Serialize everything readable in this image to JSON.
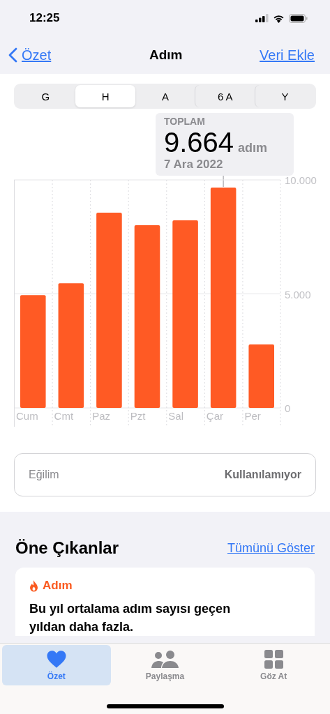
{
  "status_bar": {
    "time": "12:25"
  },
  "nav": {
    "back": "Özet",
    "title": "Adım",
    "action": "Veri Ekle"
  },
  "segments": [
    {
      "label": "G",
      "selected": false
    },
    {
      "label": "H",
      "selected": true
    },
    {
      "label": "A",
      "selected": false
    },
    {
      "label": "6 A",
      "selected": false
    },
    {
      "label": "Y",
      "selected": false
    }
  ],
  "summary": {
    "caption": "TOPLAM",
    "value": "9.664",
    "unit": "adım",
    "date": "7 Ara 2022"
  },
  "chart": {
    "chart_data": {
      "type": "bar",
      "categories": [
        "Cum",
        "Cmt",
        "Paz",
        "Pzt",
        "Sal",
        "Çar",
        "Per"
      ],
      "series": [
        {
          "color": "#ff5a24",
          "values": [
            4950,
            5470,
            8560,
            8010,
            8230,
            9660,
            2780
          ]
        }
      ],
      "ylim": [
        0,
        10000
      ],
      "yticks": [
        0,
        {
          "value": 5000,
          "label": "5.000"
        },
        {
          "value": 10000,
          "label": "10.000"
        }
      ]
    }
  },
  "trend": {
    "label": "Eğilim",
    "value": "Kullanılamıyor"
  },
  "highlights": {
    "title": "Öne Çıkanlar",
    "link": "Tümünü Göster",
    "cards": [
      {
        "category": "Adım",
        "text": "Bu yıl ortalama adım sayısı geçen yıldan daha fazla."
      }
    ]
  },
  "tab_bar": [
    {
      "kind": "summary",
      "label": "Özet",
      "selected": true
    },
    {
      "kind": "sharing",
      "label": "Paylaşma",
      "selected": false
    },
    {
      "kind": "browse",
      "label": "Göz At",
      "selected": false
    }
  ]
}
